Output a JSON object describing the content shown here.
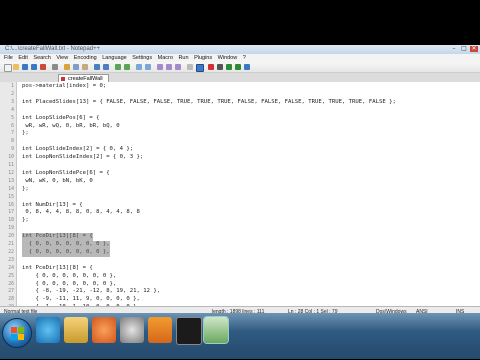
{
  "window": {
    "title": "C:\\...\\createFallWall.txt - Notepad++",
    "min": "–",
    "max": "□",
    "close": "✕"
  },
  "menu": [
    "File",
    "Edit",
    "Search",
    "View",
    "Encoding",
    "Language",
    "Settings",
    "Macro",
    "Run",
    "Plugins",
    "Window",
    "?"
  ],
  "tab": {
    "label": "createFallWall"
  },
  "lines": [
    {
      "n": "1",
      "code": "pos->material[index] = 0;",
      "state": "normal"
    },
    {
      "n": "2",
      "code": "",
      "state": "normal"
    },
    {
      "n": "3",
      "code": "int PlacedSlides[13] = { FALSE, FALSE, FALSE, TRUE, TRUE, TRUE, FALSE, FALSE, FALSE, TRUE, TRUE, TRUE, FALSE };",
      "state": "normal"
    },
    {
      "n": "4",
      "code": "",
      "state": "normal"
    },
    {
      "n": "5",
      "code": "int LoopSlidePos[6] = {",
      "state": "normal"
    },
    {
      "n": "6",
      "code": " wR, wR, wQ, 0, bR, bR, bQ, 0",
      "state": "normal"
    },
    {
      "n": "7",
      "code": "};",
      "state": "normal"
    },
    {
      "n": "8",
      "code": "",
      "state": "normal"
    },
    {
      "n": "9",
      "code": "int LoopSlideIndex[2] = { 0, 4 };",
      "state": "normal"
    },
    {
      "n": "10",
      "code": "int LoopNonSlideIndex[2] = { 0, 3 };",
      "state": "normal"
    },
    {
      "n": "11",
      "code": "",
      "state": "normal"
    },
    {
      "n": "12",
      "code": "int LoopNonSlidePce[6] = {",
      "state": "normal"
    },
    {
      "n": "13",
      "code": " wN, wK, 0, bN, bK, 0",
      "state": "normal"
    },
    {
      "n": "14",
      "code": "};",
      "state": "normal"
    },
    {
      "n": "15",
      "code": "",
      "state": "normal"
    },
    {
      "n": "16",
      "code": "int NumDir[13] = {",
      "state": "normal"
    },
    {
      "n": "17",
      "code": " 0, 8, 4, 4, 8, 8, 0, 8, 4, 4, 8, 8",
      "state": "normal"
    },
    {
      "n": "18",
      "code": "};",
      "state": "normal"
    },
    {
      "n": "19",
      "code": "",
      "state": "normal"
    },
    {
      "n": "20",
      "code": "int PceDir[13][8] = {",
      "state": "sel"
    },
    {
      "n": "21",
      "code": "  { 0, 0, 0, 0, 0, 0, 0 },",
      "state": "sel"
    },
    {
      "n": "22",
      "code": "  { 0, 0, 0, 0, 0, 0, 0 },",
      "state": "sel"
    },
    {
      "n": "23",
      "code": "",
      "state": "normal"
    },
    {
      "n": "24",
      "code": "int PceDir[13][8] = {",
      "state": "normal"
    },
    {
      "n": "25",
      "code": "    { 0, 0, 0, 0, 0, 0, 0 },",
      "state": "normal"
    },
    {
      "n": "26",
      "code": "    { 0, 0, 0, 0, 0, 0, 0 },",
      "state": "normal"
    },
    {
      "n": "27",
      "code": "    { -8, -19, -21, -12, 8, 19, 21, 12 },",
      "state": "normal"
    },
    {
      "n": "28",
      "code": "    { -9, -11, 11, 9, 0, 0, 0, 0 },",
      "state": "normal"
    },
    {
      "n": "29",
      "code": "    { -1, -10, 1, 10, 0, 0, 0, 0 },",
      "state": "normal"
    }
  ],
  "status": {
    "type": "Normal text file",
    "length": "length : 1898   lines : 111",
    "pos": "Ln : 28   Col : 1   Sel : 79",
    "eol": "Dos\\Windows",
    "enc": "ANSI",
    "ins": "INS"
  },
  "taskbar": {
    "items": [
      "ie",
      "folder",
      "media",
      "chrome",
      "vlc",
      "cmd",
      "notepad"
    ],
    "clock": ""
  }
}
